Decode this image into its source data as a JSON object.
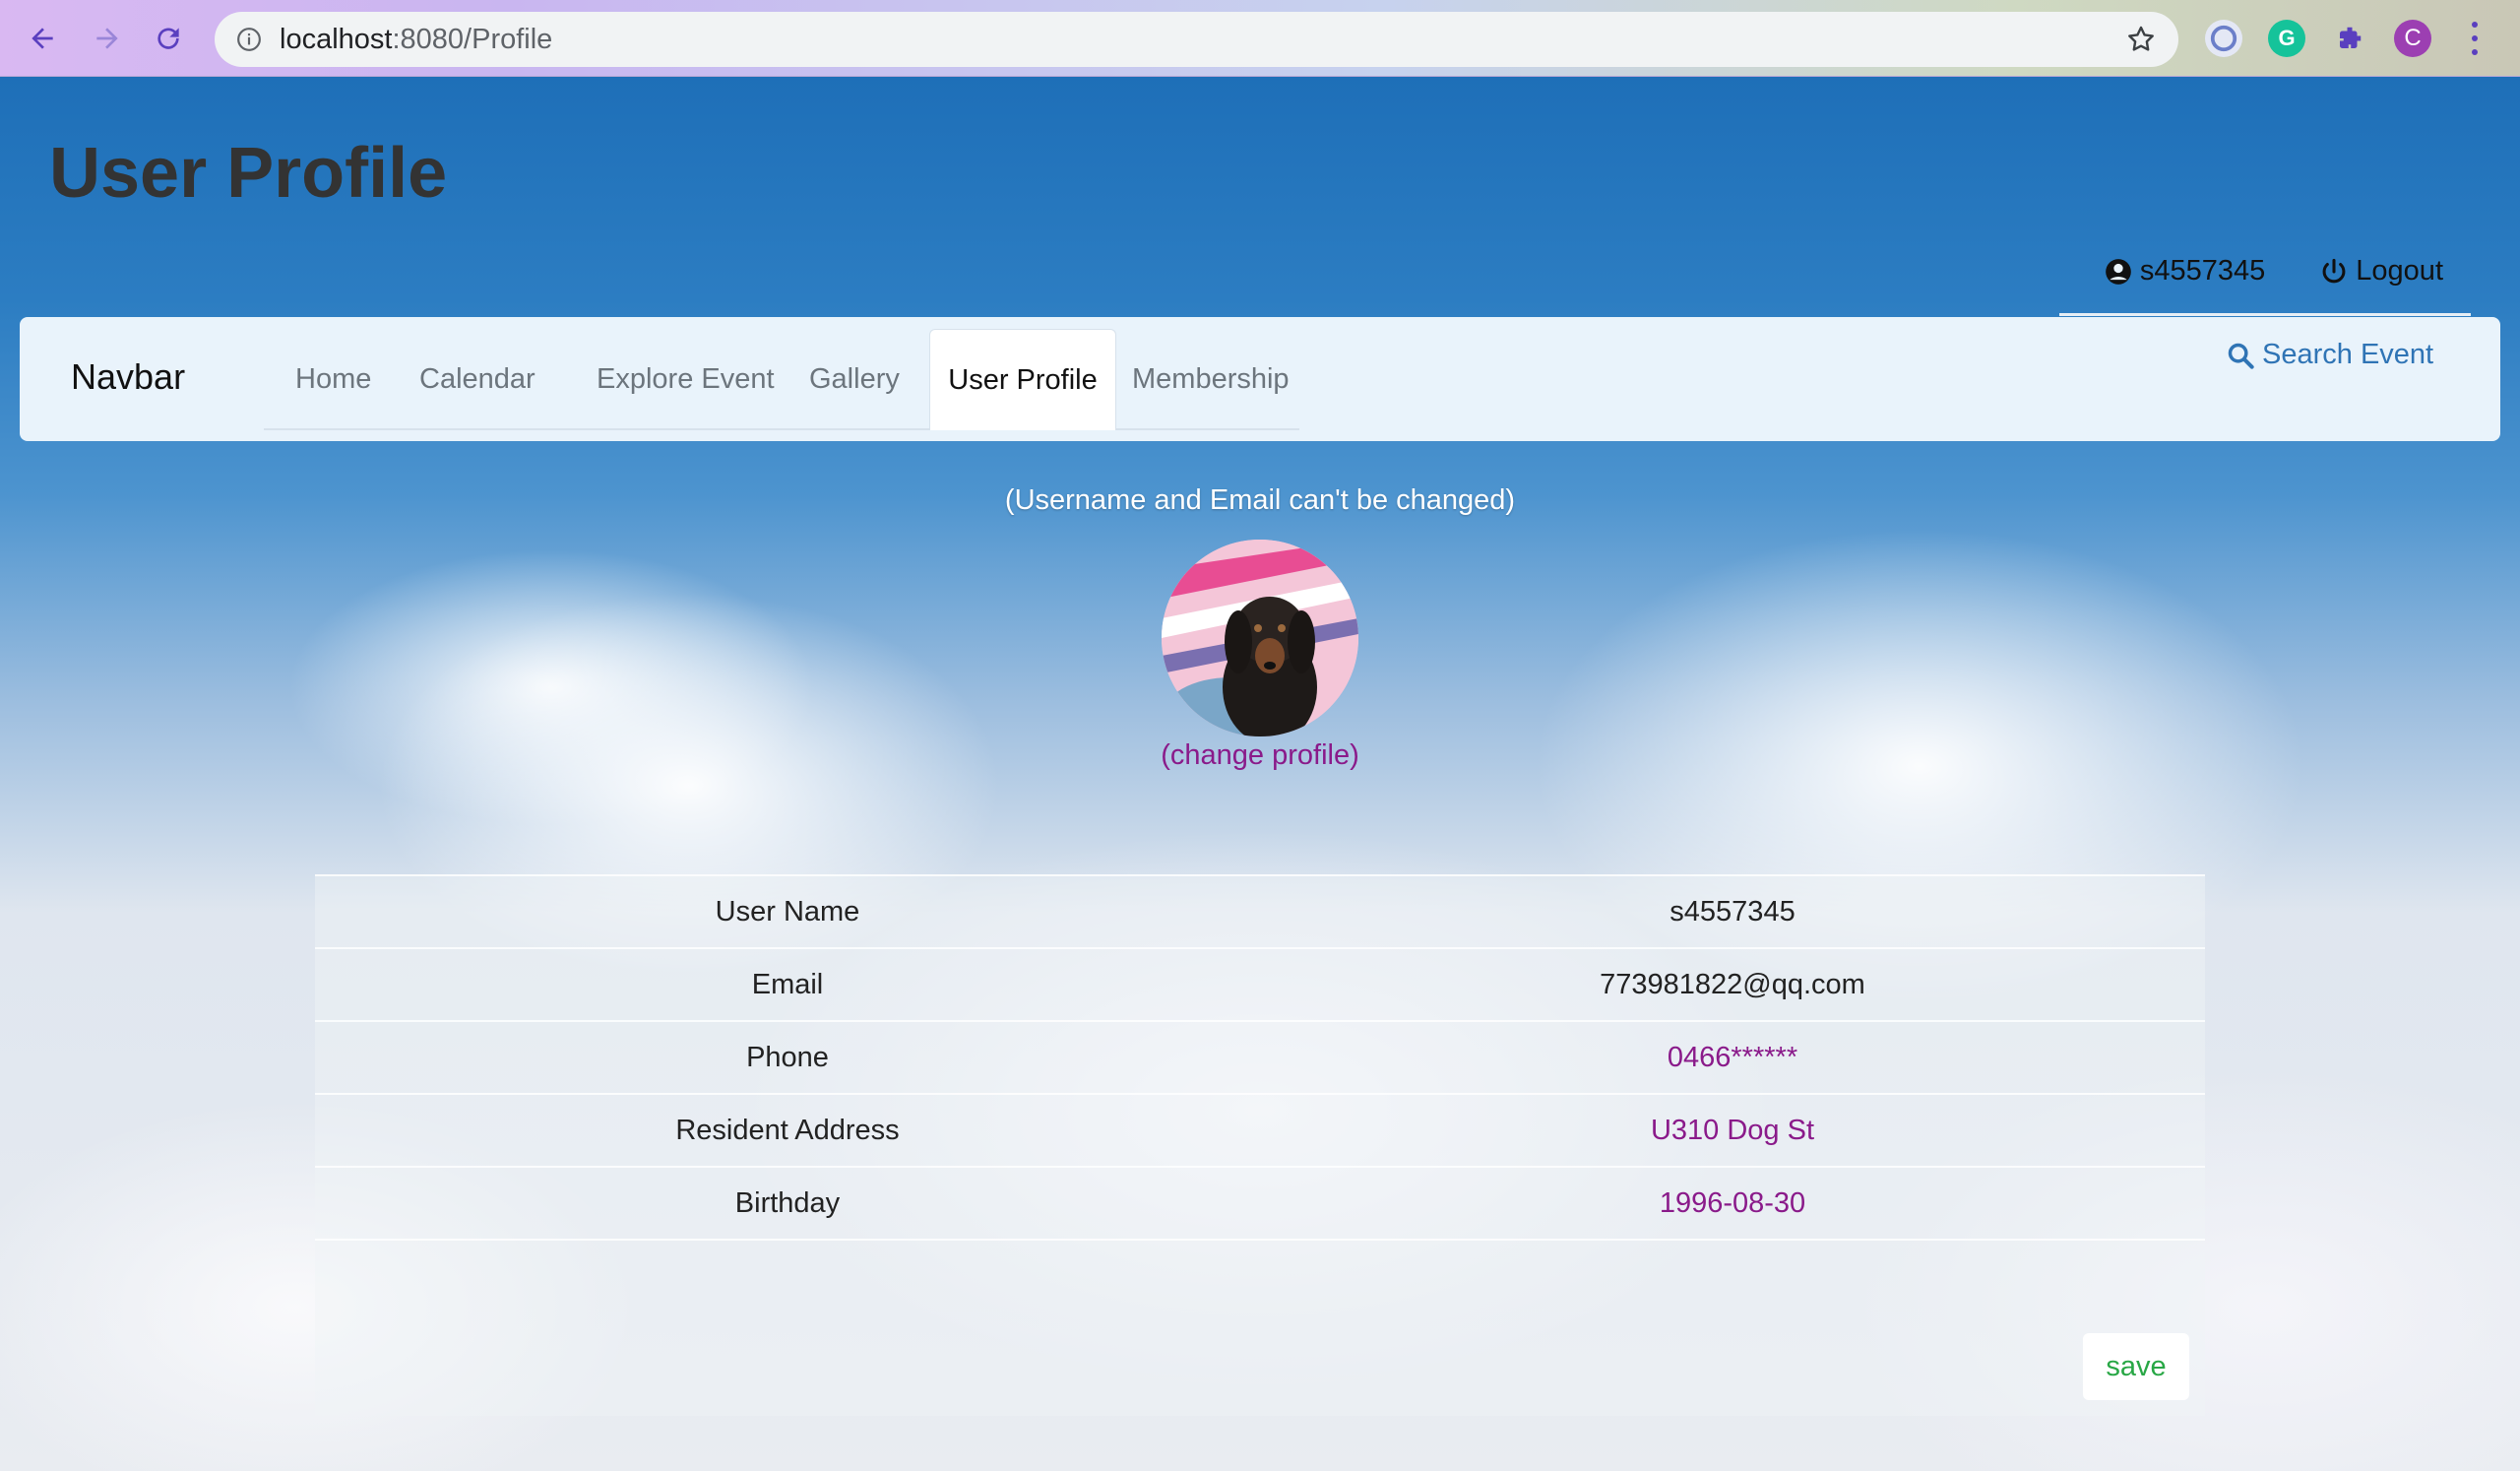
{
  "browser": {
    "url_host": "localhost",
    "url_path": ":8080/Profile",
    "profile_initial": "C",
    "grammarly_initial": "G"
  },
  "header": {
    "title": "User Profile",
    "username": "s4557345",
    "logout_label": "Logout"
  },
  "navbar": {
    "brand": "Navbar",
    "tabs": [
      {
        "label": "Home"
      },
      {
        "label": "Calendar"
      },
      {
        "label": "Explore Event"
      },
      {
        "label": "Gallery"
      },
      {
        "label": "User Profile"
      },
      {
        "label": "Membership"
      }
    ],
    "search_label": "Search Event"
  },
  "profile": {
    "notice": "(Username and Email can't be changed)",
    "change_profile_label": "(change profile)",
    "rows": [
      {
        "label": "User Name",
        "value": "s4557345"
      },
      {
        "label": "Email",
        "value": "773981822@qq.com"
      },
      {
        "label": "Phone",
        "value": "0466******"
      },
      {
        "label": "Resident Address",
        "value": "U310 Dog St"
      },
      {
        "label": "Birthday",
        "value": "1996-08-30"
      }
    ],
    "save_label": "save"
  },
  "colors": {
    "accent_link": "#2f74b5",
    "editable_value": "#8a1a8a",
    "save_text": "#28a745"
  }
}
